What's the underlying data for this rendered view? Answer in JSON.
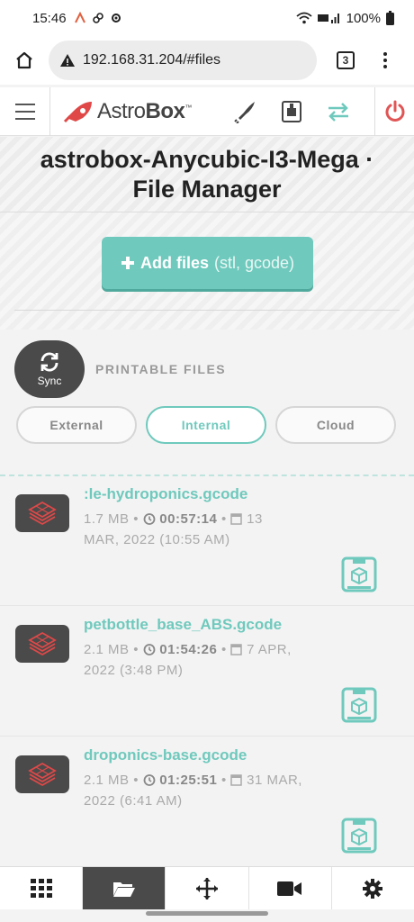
{
  "status": {
    "time": "15:46",
    "battery": "100%"
  },
  "browser": {
    "url": "192.168.31.204/#files",
    "tab_count": "3"
  },
  "app": {
    "logo_text_a": "Astro",
    "logo_text_b": "Box",
    "logo_tm": "™"
  },
  "title": {
    "line1": "astrobox-Anycubic-I3-Mega ·",
    "line2": "File Manager"
  },
  "add_files": {
    "label": "Add files",
    "types": "(stl, gcode)"
  },
  "sync": {
    "label": "Sync"
  },
  "printable_files": {
    "label": "PRINTABLE FILES"
  },
  "storage_tabs": [
    {
      "label": "External",
      "active": false
    },
    {
      "label": "Internal",
      "active": true
    },
    {
      "label": "Cloud",
      "active": false
    }
  ],
  "files": [
    {
      "name": ":le-hydroponics.gcode",
      "size": "1.7 MB",
      "duration": "00:57:14",
      "date_a": "13",
      "date_b": "MAR, 2022 (10:55 AM)"
    },
    {
      "name": "petbottle_base_ABS.gcode",
      "size": "2.1 MB",
      "duration": "01:54:26",
      "date_a": "7 APR,",
      "date_b": "2022 (3:48 PM)"
    },
    {
      "name": "droponics-base.gcode",
      "size": "2.1 MB",
      "duration": "01:25:51",
      "date_a": "31 MAR,",
      "date_b": "2022 (6:41 AM)"
    }
  ],
  "colors": {
    "accent": "#6fc9bd",
    "dark": "#4a4a4a",
    "power": "#e05555",
    "brand_red": "#e04848"
  }
}
